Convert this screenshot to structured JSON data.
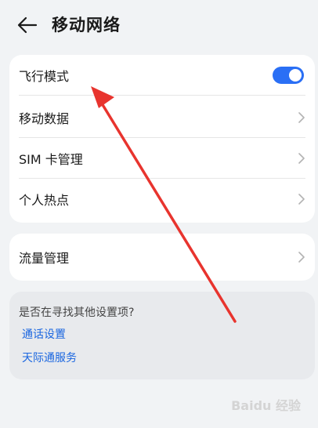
{
  "header": {
    "title": "移动网络",
    "back_icon": "arrow-left-icon"
  },
  "section1": {
    "items": [
      {
        "label": "飞行模式",
        "control": "toggle",
        "toggle_on": true
      },
      {
        "label": "移动数据",
        "control": "chevron"
      },
      {
        "label": "SIM 卡管理",
        "control": "chevron"
      },
      {
        "label": "个人热点",
        "control": "chevron"
      }
    ]
  },
  "section2": {
    "items": [
      {
        "label": "流量管理",
        "control": "chevron"
      }
    ]
  },
  "suggestions": {
    "prompt": "是否在寻找其他设置项?",
    "links": [
      "通话设置",
      "天际通服务"
    ]
  },
  "colors": {
    "accent": "#2a6ff5",
    "link": "#1a66e0",
    "annotation_arrow": "#e8342e",
    "background": "#f1f3f5"
  },
  "watermark": "Baidu 经验"
}
